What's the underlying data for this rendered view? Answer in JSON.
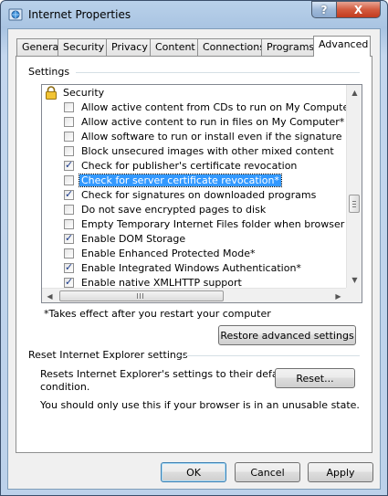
{
  "window": {
    "title": "Internet Properties",
    "help_label": "?",
    "close_label": "X"
  },
  "tabs": [
    {
      "label": "General"
    },
    {
      "label": "Security"
    },
    {
      "label": "Privacy"
    },
    {
      "label": "Content"
    },
    {
      "label": "Connections"
    },
    {
      "label": "Programs"
    },
    {
      "label": "Advanced",
      "active": true
    }
  ],
  "settings": {
    "group_label": "Settings",
    "category": "Security",
    "items": [
      {
        "label": "Allow active content from CDs to run on My Computer*",
        "checked": false
      },
      {
        "label": "Allow active content to run in files on My Computer*",
        "checked": false
      },
      {
        "label": "Allow software to run or install even if the signature is inva",
        "checked": false
      },
      {
        "label": "Block unsecured images with other mixed content",
        "checked": false
      },
      {
        "label": "Check for publisher's certificate revocation",
        "checked": true
      },
      {
        "label": "Check for server certificate revocation*",
        "checked": false,
        "selected": true
      },
      {
        "label": "Check for signatures on downloaded programs",
        "checked": true
      },
      {
        "label": "Do not save encrypted pages to disk",
        "checked": false
      },
      {
        "label": "Empty Temporary Internet Files folder when browser is clo",
        "checked": false
      },
      {
        "label": "Enable DOM Storage",
        "checked": true
      },
      {
        "label": "Enable Enhanced Protected Mode*",
        "checked": false
      },
      {
        "label": "Enable Integrated Windows Authentication*",
        "checked": true
      },
      {
        "label": "Enable native XMLHTTP support",
        "checked": true
      }
    ],
    "footnote": "*Takes effect after you restart your computer",
    "restore_label": "Restore advanced settings"
  },
  "reset": {
    "group_label": "Reset Internet Explorer settings",
    "description_line1": "Resets Internet Explorer's settings to their default",
    "description_line2": "condition.",
    "reset_label": "Reset...",
    "warning": "You should only use this if your browser is in an unusable state."
  },
  "footer": {
    "ok_label": "OK",
    "cancel_label": "Cancel",
    "apply_label": "Apply"
  }
}
